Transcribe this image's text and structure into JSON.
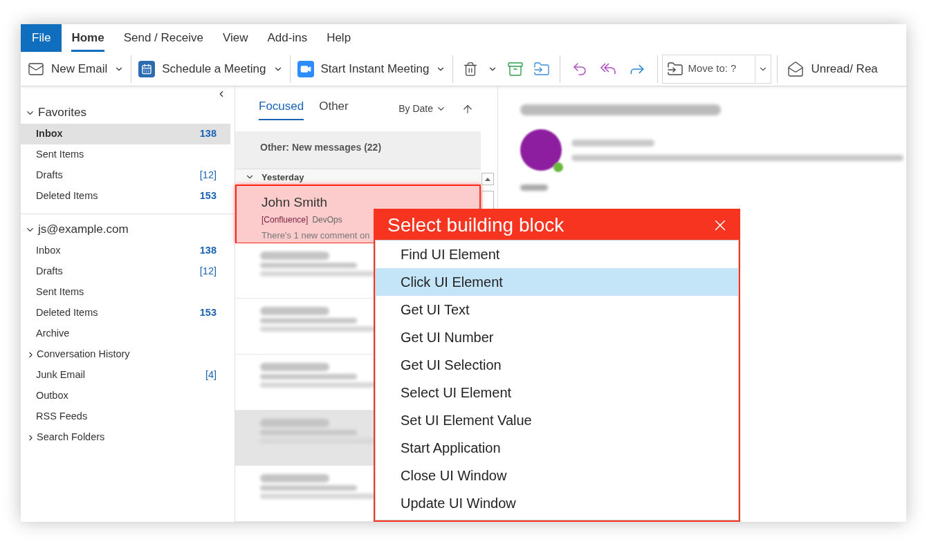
{
  "ribbon": {
    "tabs": [
      {
        "label": "File",
        "kind": "file",
        "selected": false
      },
      {
        "label": "Home",
        "kind": "tab",
        "selected": true
      },
      {
        "label": "Send / Receive",
        "kind": "tab",
        "selected": false
      },
      {
        "label": "View",
        "kind": "tab",
        "selected": false
      },
      {
        "label": "Add-ins",
        "kind": "tab",
        "selected": false
      },
      {
        "label": "Help",
        "kind": "tab",
        "selected": false
      }
    ],
    "commands": [
      {
        "kind": "mail",
        "label": "New Email"
      },
      {
        "kind": "calendar",
        "label": "Schedule a Meeting"
      },
      {
        "kind": "video",
        "label": "Start Instant Meeting"
      }
    ],
    "move_to": {
      "value": "Move to: ?"
    },
    "unread_read": {
      "label": "Unread/ Rea"
    }
  },
  "sidebar": {
    "groups": [
      {
        "label": "Favorites",
        "expanded": true,
        "items": [
          {
            "label": "Inbox",
            "count": "138",
            "count_bold": true,
            "selected": true,
            "expandable": false
          },
          {
            "label": "Sent Items",
            "selected": false,
            "expandable": false
          },
          {
            "label": "Drafts",
            "count": "[12]",
            "count_bold": false,
            "selected": false,
            "expandable": false
          },
          {
            "label": "Deleted Items",
            "count": "153",
            "count_bold": true,
            "selected": false,
            "expandable": false
          }
        ]
      },
      {
        "label": "js@example.com",
        "expanded": true,
        "items": [
          {
            "label": "Inbox",
            "count": "138",
            "count_bold": true,
            "selected": false,
            "expandable": false
          },
          {
            "label": "Drafts",
            "count": "[12]",
            "count_bold": false,
            "selected": false,
            "expandable": false
          },
          {
            "label": "Sent Items",
            "selected": false,
            "expandable": false
          },
          {
            "label": "Deleted Items",
            "count": "153",
            "count_bold": true,
            "selected": false,
            "expandable": false
          },
          {
            "label": "Archive",
            "selected": false,
            "expandable": false
          },
          {
            "label": "Conversation History",
            "selected": false,
            "expandable": true
          },
          {
            "label": "Junk Email",
            "count": "[4]",
            "count_bold": false,
            "selected": false,
            "expandable": false
          },
          {
            "label": "Outbox",
            "selected": false,
            "expandable": false
          },
          {
            "label": "RSS Feeds",
            "selected": false,
            "expandable": false
          },
          {
            "label": "Search Folders",
            "selected": false,
            "expandable": true
          }
        ]
      }
    ]
  },
  "message_list": {
    "filters": [
      {
        "label": "Focused",
        "selected": true
      },
      {
        "label": "Other",
        "selected": false
      }
    ],
    "sort": "By Date",
    "banner": "Other: New messages (22)",
    "group": {
      "label": "Yesterday",
      "expanded": true
    },
    "messages": [
      {
        "sender": "John Smith",
        "tag": "[Confluence]",
        "folder": "DevOps",
        "preview": "There's 1 new comment on",
        "highlighted": true,
        "selected": false
      },
      {
        "highlighted": false,
        "selected": false
      },
      {
        "highlighted": false,
        "selected": false
      },
      {
        "highlighted": false,
        "selected": false
      },
      {
        "highlighted": false,
        "selected": true
      },
      {
        "highlighted": false,
        "selected": false
      }
    ]
  },
  "dialog": {
    "title": "Select building block",
    "items": [
      {
        "label": "Find UI Element",
        "selected": false
      },
      {
        "label": "Click UI Element",
        "selected": true
      },
      {
        "label": "Get UI Text",
        "selected": false
      },
      {
        "label": "Get UI Number",
        "selected": false
      },
      {
        "label": "Get UI Selection",
        "selected": false
      },
      {
        "label": "Select UI Element",
        "selected": false
      },
      {
        "label": "Set UI Element Value",
        "selected": false
      },
      {
        "label": "Start Application",
        "selected": false
      },
      {
        "label": "Close UI Window",
        "selected": false
      },
      {
        "label": "Update UI Window",
        "selected": false
      }
    ]
  }
}
